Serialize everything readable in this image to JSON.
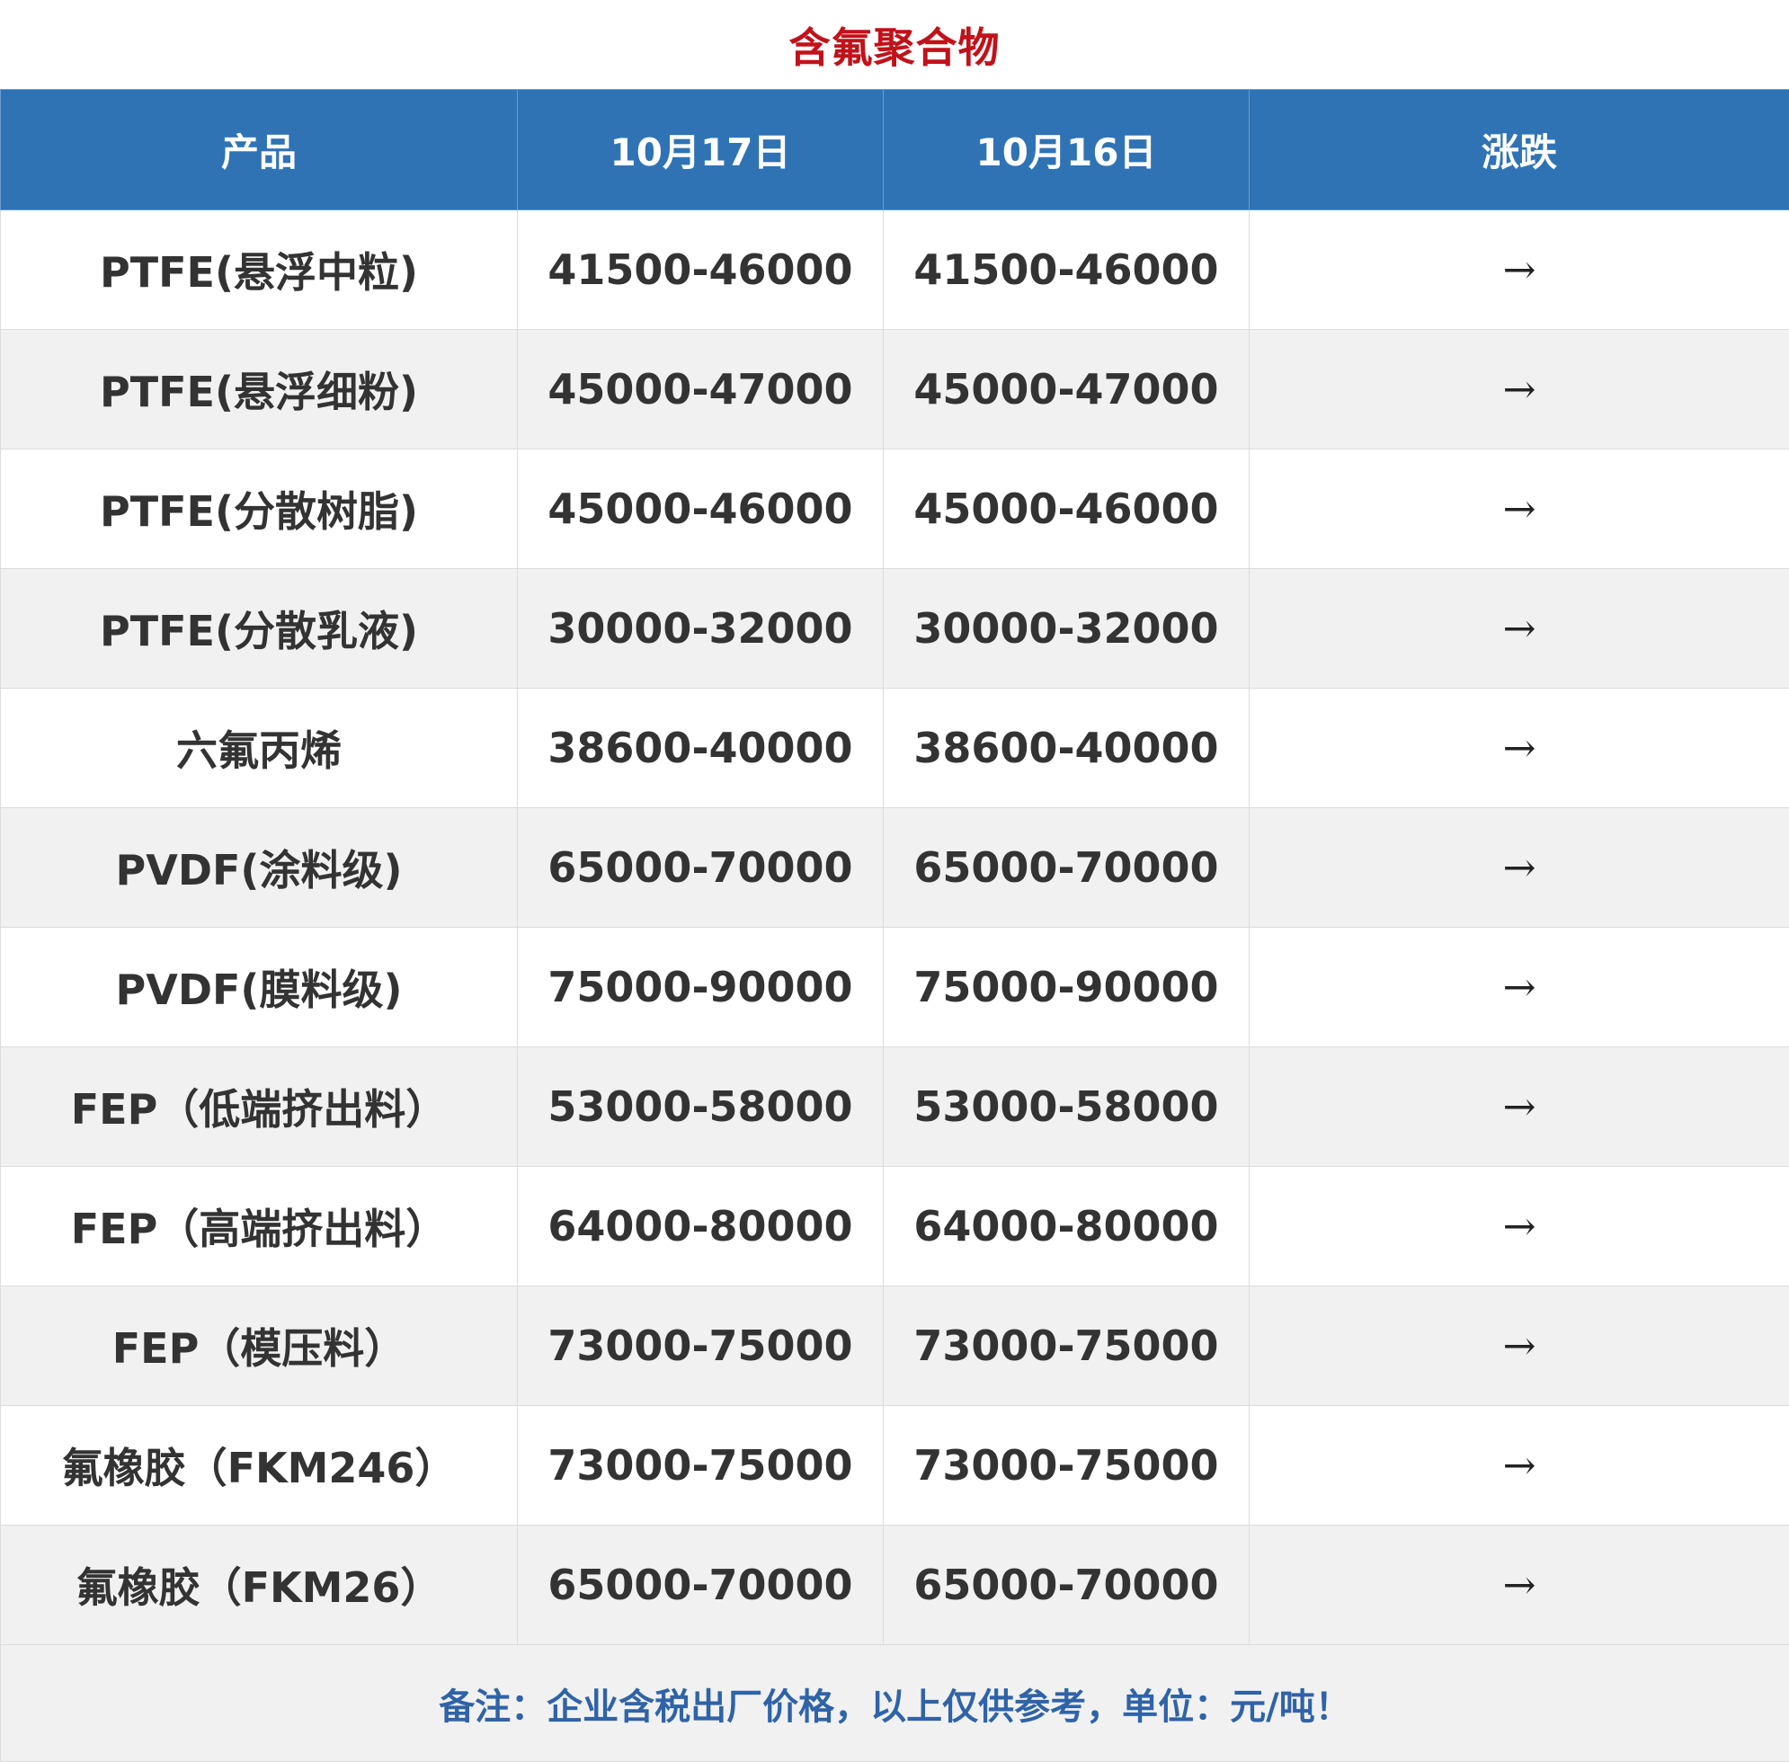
{
  "title": "含氟聚合物",
  "headers": [
    "产品",
    "10月17日",
    "10月16日",
    "涨跌"
  ],
  "rows": [
    {
      "product": "PTFE(悬浮中粒)",
      "d1": "41500-46000",
      "d2": "41500-46000",
      "change": "→"
    },
    {
      "product": "PTFE(悬浮细粉)",
      "d1": "45000-47000",
      "d2": "45000-47000",
      "change": "→"
    },
    {
      "product": "PTFE(分散树脂)",
      "d1": "45000-46000",
      "d2": "45000-46000",
      "change": "→"
    },
    {
      "product": "PTFE(分散乳液)",
      "d1": "30000-32000",
      "d2": "30000-32000",
      "change": "→"
    },
    {
      "product": "六氟丙烯",
      "d1": "38600-40000",
      "d2": "38600-40000",
      "change": "→"
    },
    {
      "product": "PVDF(涂料级)",
      "d1": "65000-70000",
      "d2": "65000-70000",
      "change": "→"
    },
    {
      "product": "PVDF(膜料级)",
      "d1": "75000-90000",
      "d2": "75000-90000",
      "change": "→"
    },
    {
      "product": "FEP（低端挤出料）",
      "d1": "53000-58000",
      "d2": "53000-58000",
      "change": "→"
    },
    {
      "product": "FEP（高端挤出料）",
      "d1": "64000-80000",
      "d2": "64000-80000",
      "change": "→"
    },
    {
      "product": "FEP（模压料）",
      "d1": "73000-75000",
      "d2": "73000-75000",
      "change": "→"
    },
    {
      "product": "氟橡胶（FKM246）",
      "d1": "73000-75000",
      "d2": "73000-75000",
      "change": "→"
    },
    {
      "product": "氟橡胶（FKM26）",
      "d1": "65000-70000",
      "d2": "65000-70000",
      "change": "→"
    }
  ],
  "footer_note": "备注：企业含税出厂价格，以上仅供参考，单位：元/吨！",
  "colors": {
    "title": "#c1121a",
    "header_bg": "#2f73b5",
    "header_text": "#ffffff",
    "row_alt_bg": "#f1f1f1",
    "footer_text": "#2f63a8"
  }
}
